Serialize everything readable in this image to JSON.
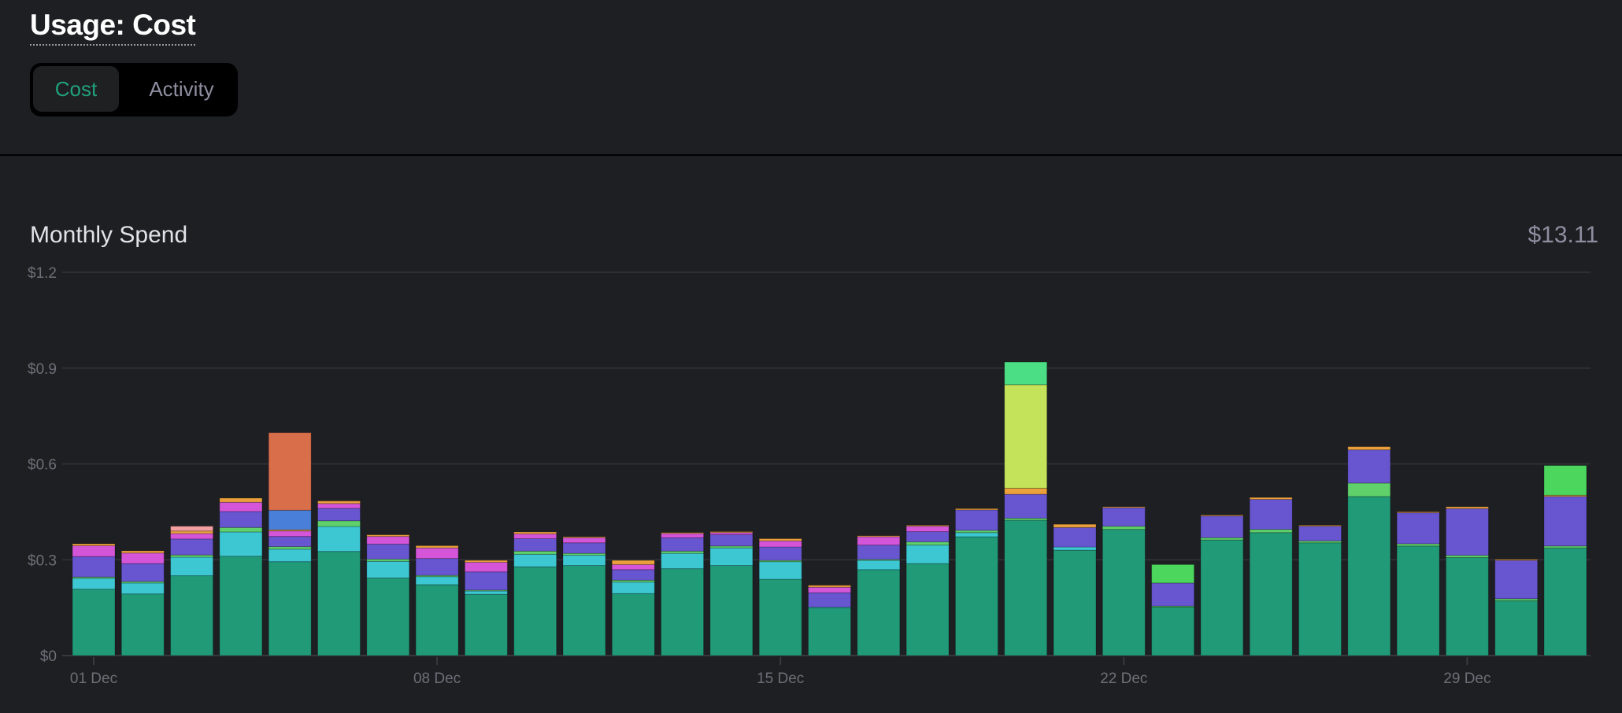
{
  "header": {
    "title": "Usage: Cost"
  },
  "tabs": [
    {
      "label": "Cost",
      "active": true
    },
    {
      "label": "Activity",
      "active": false
    }
  ],
  "section": {
    "title": "Monthly Spend",
    "total": "$13.11"
  },
  "colors": {
    "accent": "#21a07a",
    "background": "#1e1f22"
  },
  "chart_data": {
    "type": "bar",
    "stacked": true,
    "title": "Monthly Spend",
    "xlabel": "",
    "ylabel": "",
    "ylim": [
      0,
      1.2
    ],
    "yticks": [
      0,
      0.3,
      0.6,
      0.9,
      1.2
    ],
    "ytick_labels": [
      "$0",
      "$0.3",
      "$0.6",
      "$0.9",
      "$1.2"
    ],
    "grid": true,
    "categories": [
      "01 Dec",
      "02 Dec",
      "03 Dec",
      "04 Dec",
      "05 Dec",
      "06 Dec",
      "07 Dec",
      "08 Dec",
      "09 Dec",
      "10 Dec",
      "11 Dec",
      "12 Dec",
      "13 Dec",
      "14 Dec",
      "15 Dec",
      "16 Dec",
      "17 Dec",
      "18 Dec",
      "19 Dec",
      "20 Dec",
      "21 Dec",
      "22 Dec",
      "23 Dec",
      "24 Dec",
      "25 Dec",
      "26 Dec",
      "27 Dec",
      "28 Dec",
      "29 Dec",
      "30 Dec",
      "31 Dec"
    ],
    "xtick_labels": [
      {
        "index": 0,
        "label": "01 Dec"
      },
      {
        "index": 7,
        "label": "08 Dec"
      },
      {
        "index": 14,
        "label": "15 Dec"
      },
      {
        "index": 21,
        "label": "22 Dec"
      },
      {
        "index": 28,
        "label": "29 Dec"
      }
    ],
    "series": [
      {
        "color": "#219a78",
        "values": [
          0.208,
          0.193,
          0.25,
          0.311,
          0.294,
          0.326,
          0.243,
          0.222,
          0.192,
          0.278,
          0.282,
          0.194,
          0.272,
          0.282,
          0.239,
          0.149,
          0.269,
          0.288,
          0.372,
          0.424,
          0.33,
          0.395,
          0.152,
          0.362,
          0.385,
          0.353,
          0.498,
          0.343,
          0.307,
          0.172,
          0.337
        ]
      },
      {
        "color": "#3cc7d2",
        "values": [
          0.034,
          0.034,
          0.058,
          0.076,
          0.039,
          0.078,
          0.052,
          0.025,
          0.01,
          0.039,
          0.032,
          0.036,
          0.048,
          0.055,
          0.055,
          0.003,
          0.029,
          0.058,
          0.013,
          0,
          0.01,
          0,
          0,
          0,
          0,
          0,
          0,
          0,
          0,
          0,
          0
        ]
      },
      {
        "color": "#5fd06a",
        "values": [
          0.004,
          0.005,
          0.007,
          0.014,
          0.008,
          0.018,
          0.007,
          0.004,
          0.003,
          0.01,
          0.006,
          0.006,
          0.007,
          0.006,
          0.004,
          0,
          0.003,
          0.01,
          0.007,
          0.006,
          0,
          0.01,
          0.003,
          0.007,
          0.01,
          0.006,
          0.042,
          0.007,
          0.007,
          0.006,
          0.006
        ]
      },
      {
        "color": "#6856d0",
        "values": [
          0.064,
          0.056,
          0.05,
          0.05,
          0.032,
          0.039,
          0.047,
          0.053,
          0.057,
          0.039,
          0.033,
          0.033,
          0.042,
          0.036,
          0.042,
          0.045,
          0.045,
          0.032,
          0.064,
          0.075,
          0.061,
          0.058,
          0.072,
          0.068,
          0.094,
          0.046,
          0.104,
          0.097,
          0.146,
          0.12,
          0.155
        ]
      },
      {
        "color": "#d455d8",
        "values": [
          0.034,
          0.033,
          0.017,
          0.029,
          0.017,
          0.015,
          0.024,
          0.033,
          0.03,
          0.015,
          0.016,
          0.016,
          0.013,
          0.006,
          0.019,
          0.017,
          0.026,
          0.017,
          0,
          0,
          0,
          0,
          0,
          0,
          0,
          0,
          0,
          0,
          0,
          0,
          0
        ]
      },
      {
        "color": "#eba03c",
        "values": [
          0.006,
          0.007,
          0.008,
          0.013,
          0.004,
          0.008,
          0.005,
          0.007,
          0.006,
          0.006,
          0.003,
          0.013,
          0.003,
          0.003,
          0.007,
          0.006,
          0.003,
          0.003,
          0.004,
          0.019,
          0.01,
          0.003,
          0,
          0.003,
          0.006,
          0.003,
          0.01,
          0.003,
          0.006,
          0.003,
          0.004
        ]
      },
      {
        "color": "#f4a0a0",
        "values": [
          0,
          0,
          0.015,
          0,
          0,
          0,
          0,
          0,
          0,
          0,
          0,
          0,
          0,
          0,
          0,
          0,
          0,
          0,
          0,
          0,
          0,
          0,
          0,
          0,
          0,
          0,
          0,
          0,
          0,
          0,
          0
        ]
      },
      {
        "color": "#4a7fd9",
        "values": [
          0,
          0,
          0,
          0,
          0.061,
          0,
          0,
          0,
          0,
          0,
          0,
          0,
          0,
          0,
          0,
          0,
          0,
          0,
          0,
          0,
          0,
          0,
          0,
          0,
          0,
          0,
          0,
          0,
          0,
          0,
          0
        ]
      },
      {
        "color": "#d86e4a",
        "values": [
          0,
          0,
          0,
          0,
          0.243,
          0,
          0,
          0,
          0,
          0,
          0,
          0,
          0,
          0,
          0,
          0,
          0,
          0,
          0,
          0,
          0,
          0,
          0,
          0,
          0,
          0,
          0,
          0,
          0,
          0,
          0
        ]
      },
      {
        "color": "#c4e35a",
        "values": [
          0,
          0,
          0,
          0,
          0,
          0,
          0,
          0,
          0,
          0,
          0,
          0,
          0,
          0,
          0,
          0,
          0,
          0,
          0,
          0.324,
          0,
          0,
          0,
          0,
          0,
          0,
          0,
          0,
          0,
          0,
          0
        ]
      },
      {
        "color": "#4bde84",
        "values": [
          0,
          0,
          0,
          0,
          0,
          0,
          0,
          0,
          0,
          0,
          0,
          0,
          0,
          0,
          0,
          0,
          0,
          0,
          0,
          0.071,
          0,
          0,
          0,
          0,
          0,
          0,
          0,
          0,
          0,
          0,
          0
        ]
      },
      {
        "color": "#4cd65e",
        "values": [
          0,
          0,
          0,
          0,
          0,
          0,
          0,
          0,
          0,
          0,
          0,
          0,
          0,
          0,
          0,
          0,
          0,
          0,
          0,
          0,
          0,
          0,
          0.058,
          0,
          0,
          0,
          0,
          0,
          0,
          0,
          0.093
        ]
      }
    ]
  }
}
